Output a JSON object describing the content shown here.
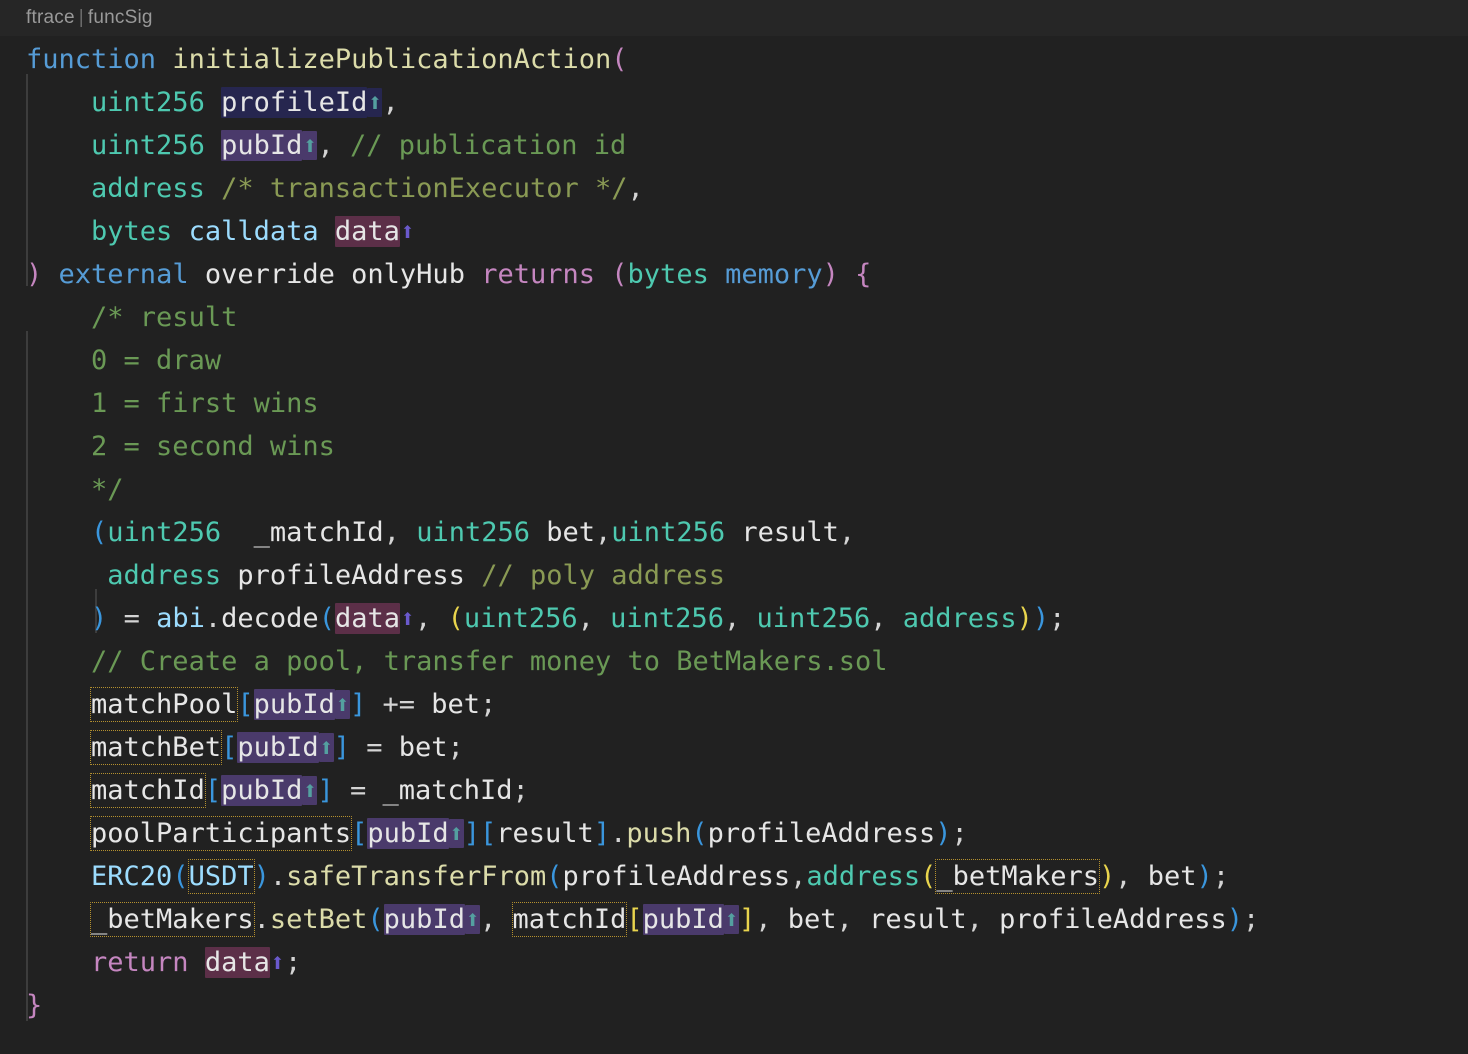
{
  "editor": {
    "codelens": {
      "left": "ftrace",
      "separator": "|",
      "right": "funcSig"
    },
    "language": "solidity",
    "theme_background": "#212121",
    "colors": {
      "keyword": "#569cd6",
      "keyword_control": "#c586c0",
      "function_name": "#dcdcaa",
      "type": "#4ec9b0",
      "comment_block": "#6a9955",
      "comment_line": "#8a9a54",
      "identifier": "#9cdcfe",
      "plain_text": "#d4d4d4",
      "bracket_level1": "#c586c0",
      "bracket_level2": "#e8d44d",
      "bracket_level3": "#3a96dd",
      "highlight_blue": "#26264f",
      "highlight_purple": "#4a3a6b",
      "highlight_wine": "#5c2f48",
      "reference_box_border": "#b5912f",
      "arrow_teal": "#54a0a0",
      "arrow_purple": "#6a5acd",
      "indent_guide": "#3d3d3d"
    }
  },
  "code": {
    "line01": {
      "kw": "function",
      "name": "initializePublicationAction",
      "paren": "("
    },
    "line02": {
      "type": "uint256",
      "var": "profileId",
      "arrow": "⬆",
      "comma": ","
    },
    "line03": {
      "type": "uint256",
      "var": "pubId",
      "arrow": "⬆",
      "comma": ",",
      "comment": "// publication id"
    },
    "line04": {
      "type": "address",
      "comment": "/* transactionExecutor */",
      "comma": ","
    },
    "line05": {
      "type": "bytes",
      "loc": "calldata",
      "var": "data",
      "arrow": "⬆"
    },
    "line06": {
      "close": ")",
      "kw1": "external",
      "kw2": "override",
      "kw3": "onlyHub",
      "kw4": "returns",
      "open": "(",
      "type": "bytes",
      "loc": "memory",
      "close2": ")",
      "brace": "{"
    },
    "line07": {
      "text": "/* result"
    },
    "line08": {
      "text": "0 = draw"
    },
    "line09": {
      "text": "1 = first wins"
    },
    "line10": {
      "text": "2 = second wins"
    },
    "line11": {
      "text": "*/"
    },
    "line12": {
      "open": "(",
      "t1": "uint256",
      "v1": "_matchId",
      "c1": ",",
      "t2": "uint256",
      "v2": "bet",
      "c2": ",",
      "t3": "uint256",
      "v3": "result",
      "c3": ","
    },
    "line13": {
      "type": "address",
      "var": "profileAddress",
      "comment": "// poly address"
    },
    "line14": {
      "close": ")",
      "eq": "=",
      "obj": "abi",
      "dot": ".",
      "method": "decode",
      "open": "(",
      "arg": "data",
      "arrow": "⬆",
      "comma": ",",
      "open2": "(",
      "t1": "uint256",
      "t2": "uint256",
      "t3": "uint256",
      "t4": "address",
      "close2": ")",
      "close3": ")",
      "semi": ";"
    },
    "line15": {
      "text": "// Create a pool, transfer money to BetMakers.sol"
    },
    "line16": {
      "map": "matchPool",
      "key": "pubId",
      "arrow": "⬆",
      "op": "+=",
      "val": "bet",
      "semi": ";"
    },
    "line17": {
      "map": "matchBet",
      "key": "pubId",
      "arrow": "⬆",
      "op": "=",
      "val": "bet",
      "semi": ";"
    },
    "line18": {
      "map": "matchId",
      "key": "pubId",
      "arrow": "⬆",
      "op": "=",
      "val": "_matchId",
      "semi": ";"
    },
    "line19": {
      "map": "poolParticipants",
      "key": "pubId",
      "arrow": "⬆",
      "key2": "result",
      "method": "push",
      "arg": "profileAddress",
      "semi": ";"
    },
    "line20": {
      "contract": "ERC20",
      "token": "USDT",
      "method": "safeTransferFrom",
      "arg1": "profileAddress",
      "cast": "address",
      "arg2": "_betMakers",
      "arg3": "bet",
      "semi": ";"
    },
    "line21": {
      "obj": "_betMakers",
      "method": "setBet",
      "a1": "pubId",
      "arrow1": "⬆",
      "map": "matchId",
      "a2": "pubId",
      "arrow2": "⬆",
      "a3": "bet",
      "a4": "result",
      "a5": "profileAddress",
      "semi": ";"
    },
    "line22": {
      "kw": "return",
      "var": "data",
      "arrow": "⬆",
      "semi": ";"
    },
    "line23": {
      "brace": "}"
    }
  }
}
